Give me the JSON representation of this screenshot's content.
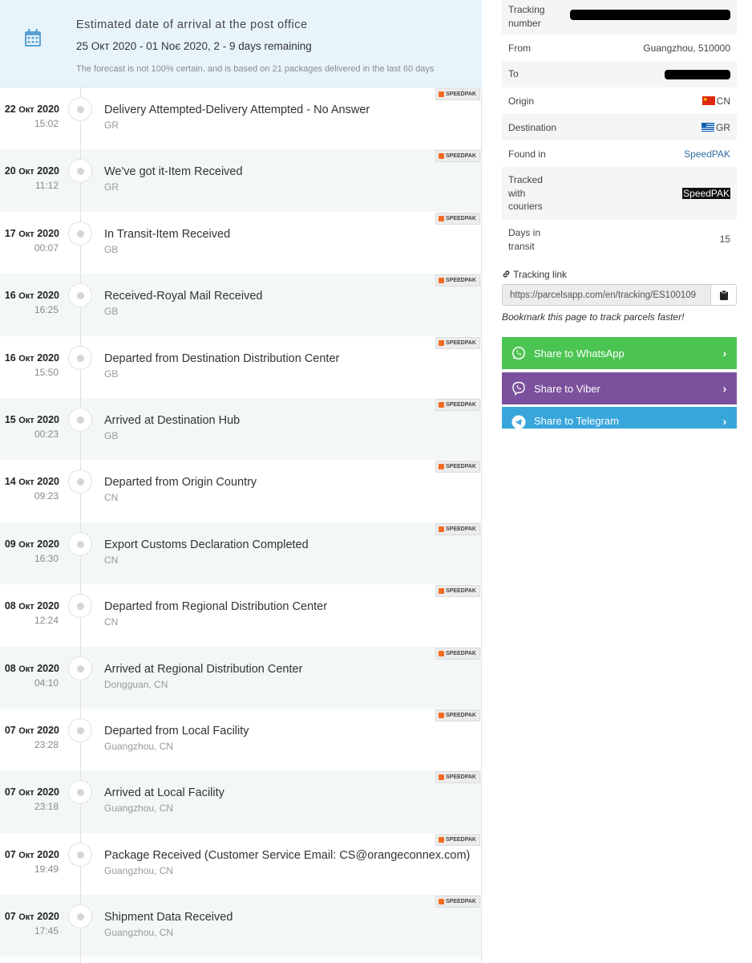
{
  "eta": {
    "title": "Estimated date of arrival at the post office",
    "range": "25 Окт 2020 - 01 Νοє 2020, 2 - 9 days remaining",
    "note": "The forecast is not 100% certain, and is based on 21 packages delivered in the last 60 days"
  },
  "courier_badge": "SPEEDPAK",
  "events": [
    {
      "day": "22",
      "month": "Окт",
      "year": "2020",
      "time": "15:02",
      "title": "Delivery Attempted-Delivery Attempted - No Answer",
      "location": "GR"
    },
    {
      "day": "20",
      "month": "Окт",
      "year": "2020",
      "time": "11:12",
      "title": "We've got it-Item Received",
      "location": "GR"
    },
    {
      "day": "17",
      "month": "Окт",
      "year": "2020",
      "time": "00:07",
      "title": "In Transit-Item Received",
      "location": "GB"
    },
    {
      "day": "16",
      "month": "Окт",
      "year": "2020",
      "time": "16:25",
      "title": "Received-Royal Mail Received",
      "location": "GB"
    },
    {
      "day": "16",
      "month": "Окт",
      "year": "2020",
      "time": "15:50",
      "title": "Departed from Destination Distribution Center",
      "location": "GB"
    },
    {
      "day": "15",
      "month": "Окт",
      "year": "2020",
      "time": "00:23",
      "title": "Arrived at Destination Hub",
      "location": "GB"
    },
    {
      "day": "14",
      "month": "Окт",
      "year": "2020",
      "time": "09:23",
      "title": "Departed from Origin Country",
      "location": "CN"
    },
    {
      "day": "09",
      "month": "Окт",
      "year": "2020",
      "time": "16:30",
      "title": "Export Customs Declaration Completed",
      "location": "CN"
    },
    {
      "day": "08",
      "month": "Окт",
      "year": "2020",
      "time": "12:24",
      "title": "Departed from Regional Distribution Center",
      "location": "CN"
    },
    {
      "day": "08",
      "month": "Окт",
      "year": "2020",
      "time": "04:10",
      "title": "Arrived at Regional Distribution Center",
      "location": "Dongguan, CN"
    },
    {
      "day": "07",
      "month": "Окт",
      "year": "2020",
      "time": "23:28",
      "title": "Departed from Local Facility",
      "location": "Guangzhou, CN"
    },
    {
      "day": "07",
      "month": "Окт",
      "year": "2020",
      "time": "23:18",
      "title": "Arrived at Local Facility",
      "location": "Guangzhou, CN"
    },
    {
      "day": "07",
      "month": "Окт",
      "year": "2020",
      "time": "19:49",
      "title": "Package Received (Customer Service Email: CS@orangeconnex.com)",
      "location": "Guangzhou, CN"
    },
    {
      "day": "07",
      "month": "Окт",
      "year": "2020",
      "time": "17:45",
      "title": "Shipment Data Received",
      "location": "Guangzhou, CN"
    }
  ],
  "info": {
    "tracking_number_label": "Tracking number",
    "from_label": "From",
    "from_value": "Guangzhou, 510000",
    "to_label": "To",
    "origin_label": "Origin",
    "origin_value": "CN",
    "destination_label": "Destination",
    "destination_value": "GR",
    "found_in_label": "Found in",
    "found_in_value": "SpeedPAK",
    "tracked_with_label": "Tracked with couriers",
    "tracked_with_value": "SpeedPAK",
    "days_label": "Days in transit",
    "days_value": "15"
  },
  "tracking_link": {
    "label": "Tracking link",
    "url": "https://parcelsapp.com/en/tracking/ES100109"
  },
  "bookmark_text": "Bookmark this page to track parcels faster!",
  "share": {
    "whatsapp": "Share to WhatsApp",
    "viber": "Share to Viber",
    "telegram": "Share to Telegram"
  },
  "colors": {
    "whatsapp": "#4cc452",
    "viber": "#7b519d",
    "telegram": "#38a6db",
    "eta_bg": "#e8f4fc",
    "calendar_icon": "#5a9fd4"
  }
}
